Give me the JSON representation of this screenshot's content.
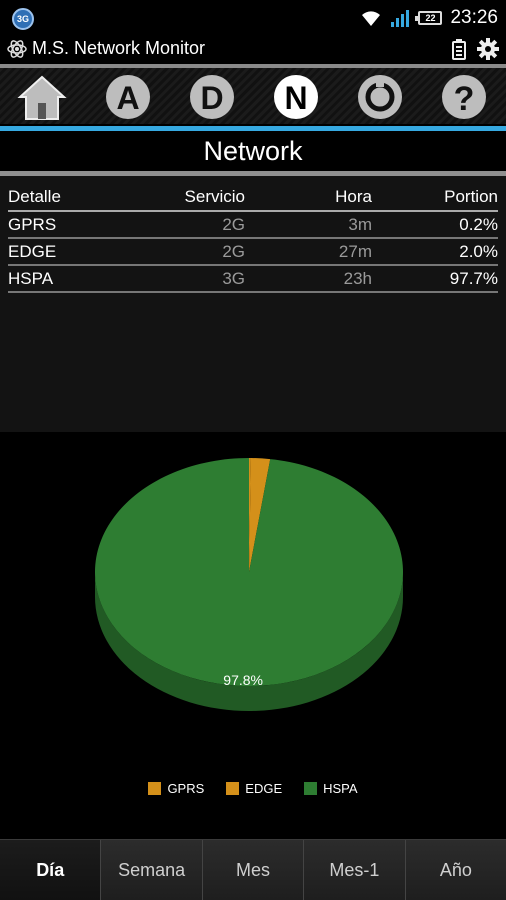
{
  "status_bar": {
    "network_badge": "3G",
    "battery_level": "22",
    "time": "23:26",
    "icons": [
      "wifi-icon",
      "signal-icon",
      "battery-icon"
    ]
  },
  "app": {
    "title": "M.S. Network Monitor"
  },
  "toolbar": {
    "buttons": [
      {
        "name": "home-icon"
      },
      {
        "name": "a-icon",
        "letter": "A"
      },
      {
        "name": "d-icon",
        "letter": "D"
      },
      {
        "name": "n-icon",
        "letter": "N",
        "active": true
      },
      {
        "name": "refresh-icon"
      },
      {
        "name": "help-icon",
        "letter": "?"
      }
    ]
  },
  "header": {
    "title": "Network"
  },
  "table": {
    "columns": [
      "Detalle",
      "Servicio",
      "Hora",
      "Portion"
    ],
    "rows": [
      [
        "GPRS",
        "2G",
        "3m",
        "0.2%"
      ],
      [
        "EDGE",
        "2G",
        "27m",
        "2.0%"
      ],
      [
        "HSPA",
        "3G",
        "23h",
        "97.7%"
      ]
    ]
  },
  "chart_data": {
    "type": "pie",
    "categories": [
      "GPRS",
      "EDGE",
      "HSPA"
    ],
    "values": [
      0.2,
      2.0,
      97.8
    ],
    "colors": [
      "#d4901a",
      "#d4901a",
      "#2e7d32"
    ],
    "data_labels": [
      "",
      "",
      "97.8%"
    ],
    "legend": "bottom-center",
    "style": "3d"
  },
  "tabs": [
    {
      "label": "Día",
      "active": true
    },
    {
      "label": "Semana",
      "active": false
    },
    {
      "label": "Mes",
      "active": false
    },
    {
      "label": "Mes-1",
      "active": false
    },
    {
      "label": "Año",
      "active": false
    }
  ]
}
